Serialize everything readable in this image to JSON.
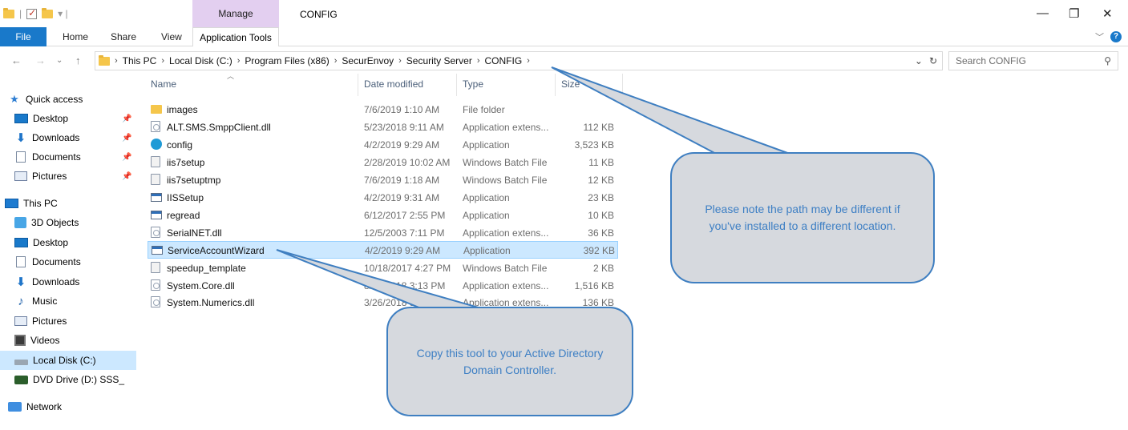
{
  "titlebar": {
    "manage_label": "Manage",
    "title": "CONFIG",
    "minimize": "—",
    "restore": "❐",
    "close": "✕"
  },
  "ribbon": {
    "tabs": [
      "File",
      "Home",
      "Share",
      "View"
    ],
    "application_tools": "Application Tools"
  },
  "address": {
    "crumbs": [
      "This PC",
      "Local Disk (C:)",
      "Program Files (x86)",
      "SecurEnvoy",
      "Security Server",
      "CONFIG"
    ],
    "search_placeholder": "Search CONFIG"
  },
  "nav_pane": {
    "items": [
      {
        "label": "Quick access",
        "icon": "star-icon"
      },
      {
        "label": "Desktop",
        "icon": "desktop-icon",
        "pinned": true
      },
      {
        "label": "Downloads",
        "icon": "download-icon",
        "pinned": true
      },
      {
        "label": "Documents",
        "icon": "documents-icon",
        "pinned": true
      },
      {
        "label": "Pictures",
        "icon": "pictures-icon",
        "pinned": true
      },
      {
        "label": "This PC",
        "icon": "computer-icon"
      },
      {
        "label": "3D Objects",
        "icon": "3d-objects-icon"
      },
      {
        "label": "Desktop",
        "icon": "desktop-icon"
      },
      {
        "label": "Documents",
        "icon": "documents-icon"
      },
      {
        "label": "Downloads",
        "icon": "download-icon"
      },
      {
        "label": "Music",
        "icon": "music-icon"
      },
      {
        "label": "Pictures",
        "icon": "pictures-icon"
      },
      {
        "label": "Videos",
        "icon": "videos-icon"
      },
      {
        "label": "Local Disk (C:)",
        "icon": "local-disk-icon",
        "selected": true
      },
      {
        "label": "DVD Drive (D:) SSS_",
        "icon": "dvd-drive-icon"
      },
      {
        "label": "Network",
        "icon": "network-icon"
      }
    ]
  },
  "columns": {
    "name": "Name",
    "date": "Date modified",
    "type": "Type",
    "size": "Size"
  },
  "files": [
    {
      "name": "images",
      "date": "7/6/2019 1:10 AM",
      "type": "File folder",
      "size": "",
      "icon": "folder-icon"
    },
    {
      "name": "ALT.SMS.SmppClient.dll",
      "date": "5/23/2018 9:11 AM",
      "type": "Application extens...",
      "size": "112 KB",
      "icon": "dll-icon"
    },
    {
      "name": "config",
      "date": "4/2/2019 9:29 AM",
      "type": "Application",
      "size": "3,523 KB",
      "icon": "config-app-icon"
    },
    {
      "name": "iis7setup",
      "date": "2/28/2019 10:02 AM",
      "type": "Windows Batch File",
      "size": "11 KB",
      "icon": "batch-file-icon"
    },
    {
      "name": "iis7setuptmp",
      "date": "7/6/2019 1:18 AM",
      "type": "Windows Batch File",
      "size": "12 KB",
      "icon": "batch-file-icon"
    },
    {
      "name": "IISSetup",
      "date": "4/2/2019 9:31 AM",
      "type": "Application",
      "size": "23 KB",
      "icon": "application-icon"
    },
    {
      "name": "regread",
      "date": "6/12/2017 2:55 PM",
      "type": "Application",
      "size": "10 KB",
      "icon": "application-icon"
    },
    {
      "name": "SerialNET.dll",
      "date": "12/5/2003 7:11 PM",
      "type": "Application extens...",
      "size": "36 KB",
      "icon": "dll-icon"
    },
    {
      "name": "ServiceAccountWizard",
      "date": "4/2/2019 9:29 AM",
      "type": "Application",
      "size": "392 KB",
      "icon": "application-icon",
      "selected": true
    },
    {
      "name": "speedup_template",
      "date": "10/18/2017 4:27 PM",
      "type": "Windows Batch File",
      "size": "2 KB",
      "icon": "batch-file-icon"
    },
    {
      "name": "System.Core.dll",
      "date": "8/30/2018 3:13 PM",
      "type": "Application extens...",
      "size": "1,516 KB",
      "icon": "dll-icon"
    },
    {
      "name": "System.Numerics.dll",
      "date": "3/26/2018 5:38 PM",
      "type": "Application extens...",
      "size": "136 KB",
      "icon": "dll-icon"
    }
  ],
  "callouts": {
    "path_note": "Please note the path may be different if you've installed to a different location.",
    "copy_note": "Copy this tool to your Active Directory Domain Controller."
  },
  "colors": {
    "accent": "#1979ca",
    "manage_tab": "#e3cff0",
    "selection": "#cce8ff",
    "callout_fill": "#d6d9de",
    "callout_border": "#3f7fc1"
  }
}
